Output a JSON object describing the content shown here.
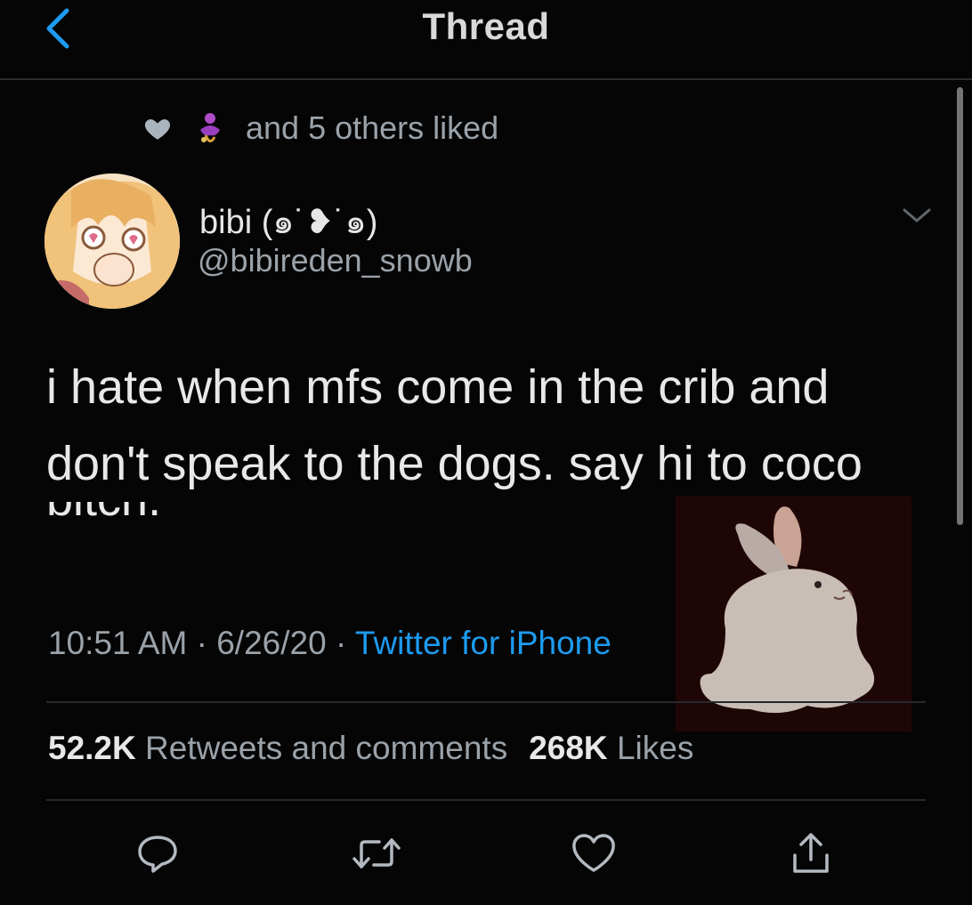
{
  "header": {
    "back_icon": "chevron-left-icon",
    "title": "Thread"
  },
  "social_context": {
    "icon": "heart-icon",
    "text": "and 5 others liked"
  },
  "author": {
    "display_name": "bibi (๑˙❥˙๑)",
    "handle": "@bibireden_snowb"
  },
  "tweet": {
    "line1": "i hate when mfs come in the crib and",
    "line2": "don't speak to the dogs. say hi to coco",
    "line3": "bitch."
  },
  "meta": {
    "time": "10:51 AM",
    "separator1": " · ",
    "date": "6/26/20",
    "separator2": " · ",
    "source": "Twitter for iPhone"
  },
  "stats": {
    "retweets_count": "52.2K",
    "retweets_label": "Retweets and comments",
    "likes_count": "268K",
    "likes_label": "Likes"
  },
  "actions": [
    "reply-icon",
    "retweet-icon",
    "like-icon",
    "share-icon"
  ],
  "colors": {
    "background": "#000000",
    "accent": "#1d9bf0",
    "secondary_text": "#9aa2aa",
    "primary_text": "#e8e8e8"
  }
}
